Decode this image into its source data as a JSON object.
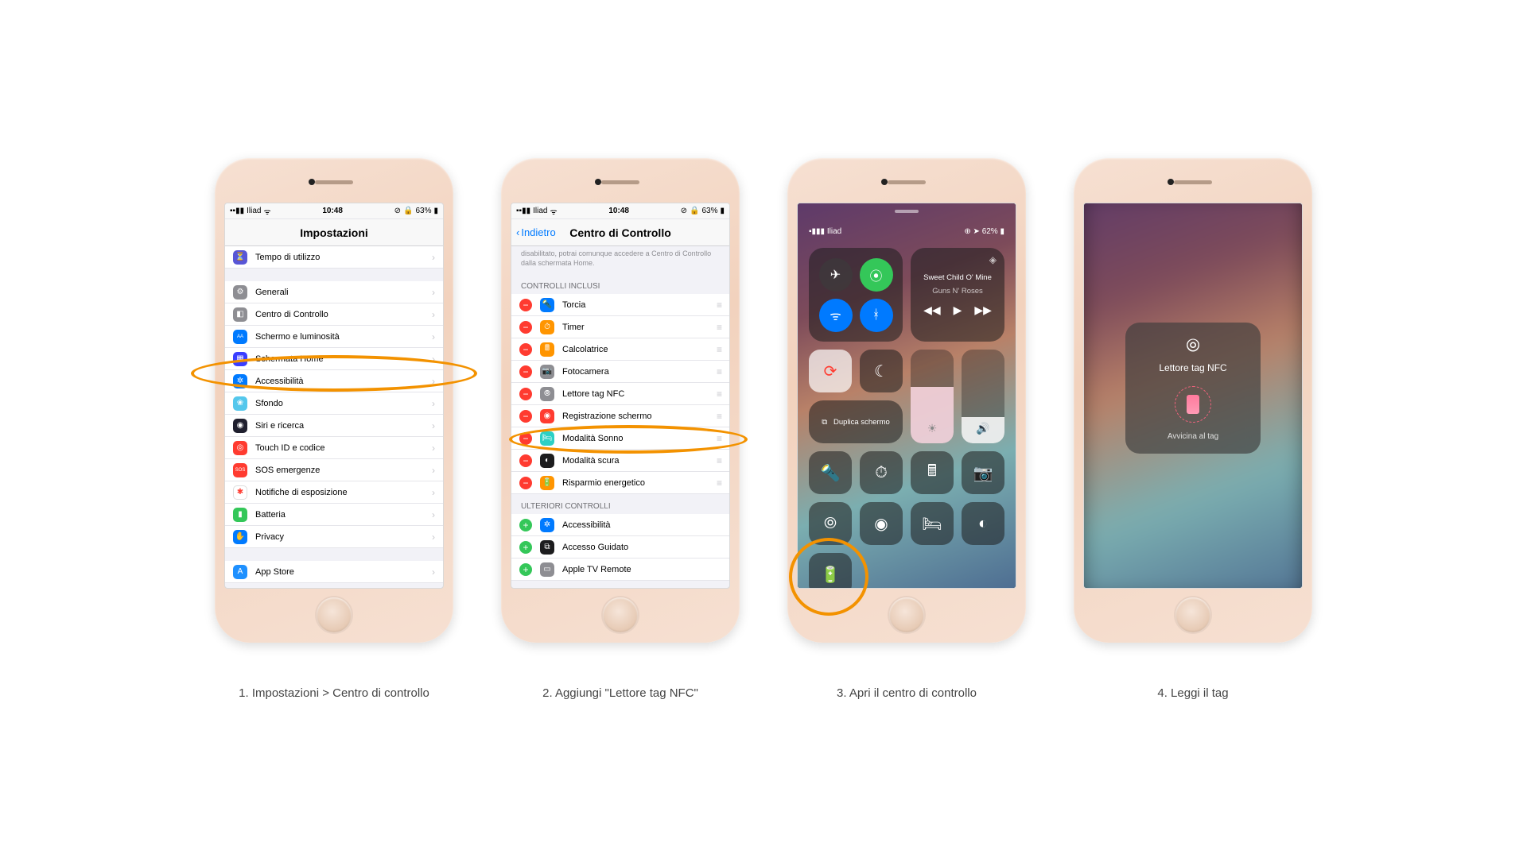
{
  "captions": {
    "s1": "1. Impostazioni > Centro di controllo",
    "s2": "2. Aggiungi \"Lettore tag NFC\"",
    "s3": "3. Apri il centro di controllo",
    "s4": "4. Leggi il tag"
  },
  "status": {
    "carrier": "Iliad",
    "time": "10:48",
    "battery": "63%",
    "battery_cc": "62%"
  },
  "screen1": {
    "title": "Impostazioni",
    "rows": [
      {
        "label": "Tempo di utilizzo",
        "color": "#5856d6",
        "glyph": "⏳"
      },
      {
        "label": "Generali",
        "color": "#8e8e93",
        "glyph": "⚙"
      },
      {
        "label": "Centro di Controllo",
        "color": "#8e8e93",
        "glyph": "◧"
      },
      {
        "label": "Schermo e luminosità",
        "color": "#007aff",
        "glyph": "AA"
      },
      {
        "label": "Schermata Home",
        "color": "#3a3eff",
        "glyph": "▦"
      },
      {
        "label": "Accessibilità",
        "color": "#007aff",
        "glyph": "✲"
      },
      {
        "label": "Sfondo",
        "color": "#54c7ec",
        "glyph": "❀"
      },
      {
        "label": "Siri e ricerca",
        "color": "#1f1f2e",
        "glyph": "◉"
      },
      {
        "label": "Touch ID e codice",
        "color": "#ff3b30",
        "glyph": "◎"
      },
      {
        "label": "SOS emergenze",
        "color": "#ff3b30",
        "glyph": "SOS"
      },
      {
        "label": "Notifiche di esposizione",
        "color": "#ffffff",
        "glyph": "✱"
      },
      {
        "label": "Batteria",
        "color": "#34c759",
        "glyph": "▮"
      },
      {
        "label": "Privacy",
        "color": "#007aff",
        "glyph": "✋"
      },
      {
        "label": "App Store",
        "color": "#1e90ff",
        "glyph": "A"
      }
    ]
  },
  "screen2": {
    "back": "Indietro",
    "title": "Centro di Controllo",
    "note": "disabilitato, potrai comunque accedere a Centro di Controllo dalla schermata Home.",
    "included_header": "CONTROLLI INCLUSI",
    "included": [
      {
        "label": "Torcia",
        "color": "#007aff",
        "glyph": "🔦"
      },
      {
        "label": "Timer",
        "color": "#ff9500",
        "glyph": "⏱"
      },
      {
        "label": "Calcolatrice",
        "color": "#ff9500",
        "glyph": "🖩"
      },
      {
        "label": "Fotocamera",
        "color": "#8e8e93",
        "glyph": "📷"
      },
      {
        "label": "Lettore tag NFC",
        "color": "#8e8e93",
        "glyph": "⦾"
      },
      {
        "label": "Registrazione schermo",
        "color": "#ff3b30",
        "glyph": "◉"
      },
      {
        "label": "Modalità Sonno",
        "color": "#2cd0c5",
        "glyph": "🛏"
      },
      {
        "label": "Modalità scura",
        "color": "#1c1c1e",
        "glyph": "◐"
      },
      {
        "label": "Risparmio energetico",
        "color": "#ff9500",
        "glyph": "🔋"
      }
    ],
    "more_header": "ULTERIORI CONTROLLI",
    "more": [
      {
        "label": "Accessibilità",
        "color": "#007aff",
        "glyph": "✲"
      },
      {
        "label": "Accesso Guidato",
        "color": "#1c1c1e",
        "glyph": "⧉"
      },
      {
        "label": "Apple TV Remote",
        "color": "#8e8e93",
        "glyph": "▭"
      }
    ]
  },
  "screen3": {
    "song": "Sweet Child O' Mine",
    "artist": "Guns N' Roses",
    "screen_mirror": "Duplica schermo"
  },
  "screen4": {
    "title": "Lettore tag NFC",
    "hint": "Avvicina al tag"
  }
}
